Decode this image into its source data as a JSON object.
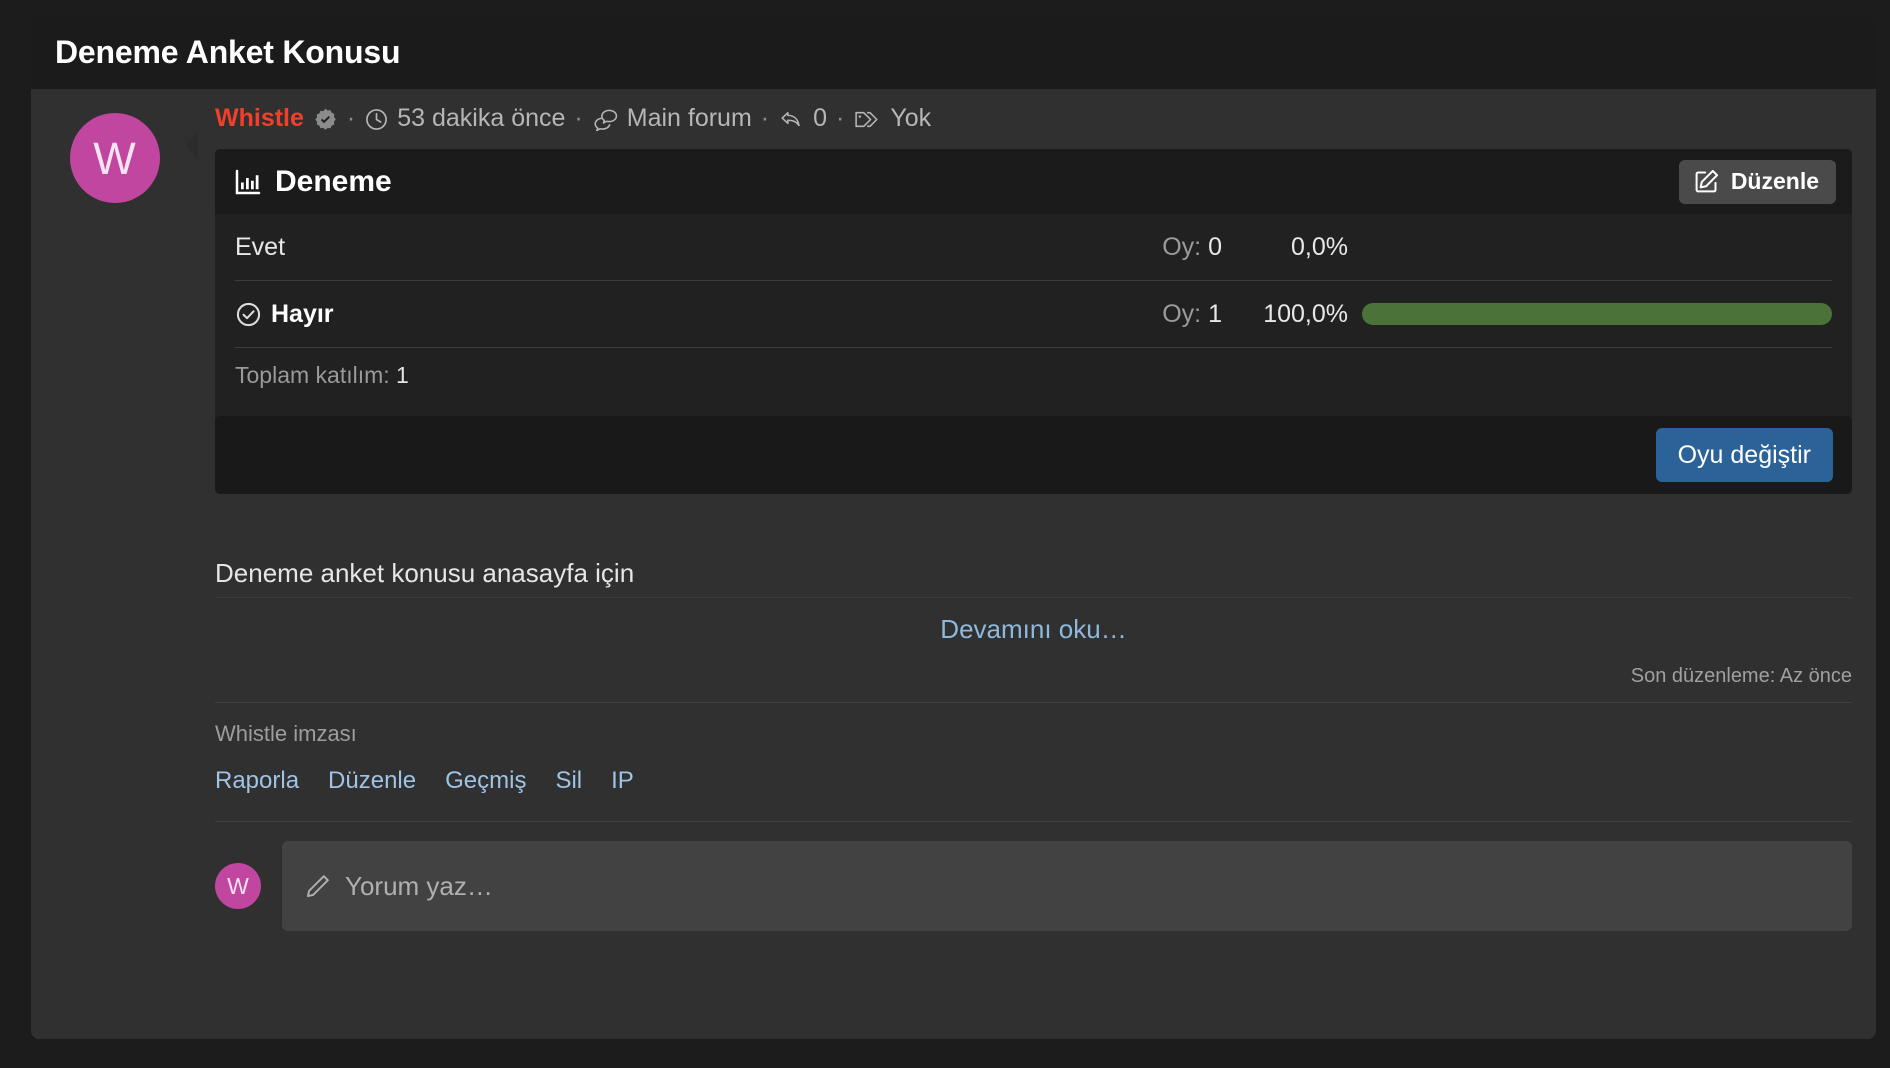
{
  "thread": {
    "title": "Deneme Anket Konusu"
  },
  "post": {
    "avatar_initial": "W",
    "meta": {
      "author": "Whistle",
      "verified_icon": "verified-badge-icon",
      "sep": "·",
      "time_icon": "clock-icon",
      "time": "53 dakika önce",
      "forum_icon": "forums-icon",
      "forum": "Main forum",
      "replies_icon": "reply-arrow-icon",
      "replies": "0",
      "tags_icon": "tag-icon",
      "tags": "Yok"
    },
    "poll": {
      "icon": "bar-chart-icon",
      "title": "Deneme",
      "edit_button": {
        "icon": "pencil-square-icon",
        "label": "Düzenle"
      },
      "options": [
        {
          "label": "Evet",
          "voted": false,
          "votes_label": "Oy:",
          "votes": "0",
          "percent_label": "0,0%",
          "percent": 0
        },
        {
          "label": "Hayır",
          "voted": true,
          "voted_icon": "check-circle-icon",
          "votes_label": "Oy:",
          "votes": "1",
          "percent_label": "100,0%",
          "percent": 100
        }
      ],
      "total_label": "Toplam katılım:",
      "total_value": "1",
      "change_vote_button": "Oyu değiştir",
      "bar_color": "#4b7339"
    },
    "message": "Deneme anket konusu anasayfa için",
    "read_more": "Devamını oku…",
    "last_edit": "Son düzenleme: Az önce",
    "signature": "Whistle imzası",
    "actions": [
      {
        "label": "Raporla"
      },
      {
        "label": "Düzenle"
      },
      {
        "label": "Geçmiş"
      },
      {
        "label": "Sil"
      },
      {
        "label": "IP"
      }
    ]
  },
  "composer": {
    "avatar_initial": "W",
    "pencil_icon": "pencil-icon",
    "placeholder": "Yorum yaz…"
  },
  "colors": {
    "accent_author": "#f0402a",
    "link": "#9fc3e4",
    "primary_button": "#2b6398",
    "poll_bar": "#4b7339",
    "avatar": "#c0469f"
  }
}
